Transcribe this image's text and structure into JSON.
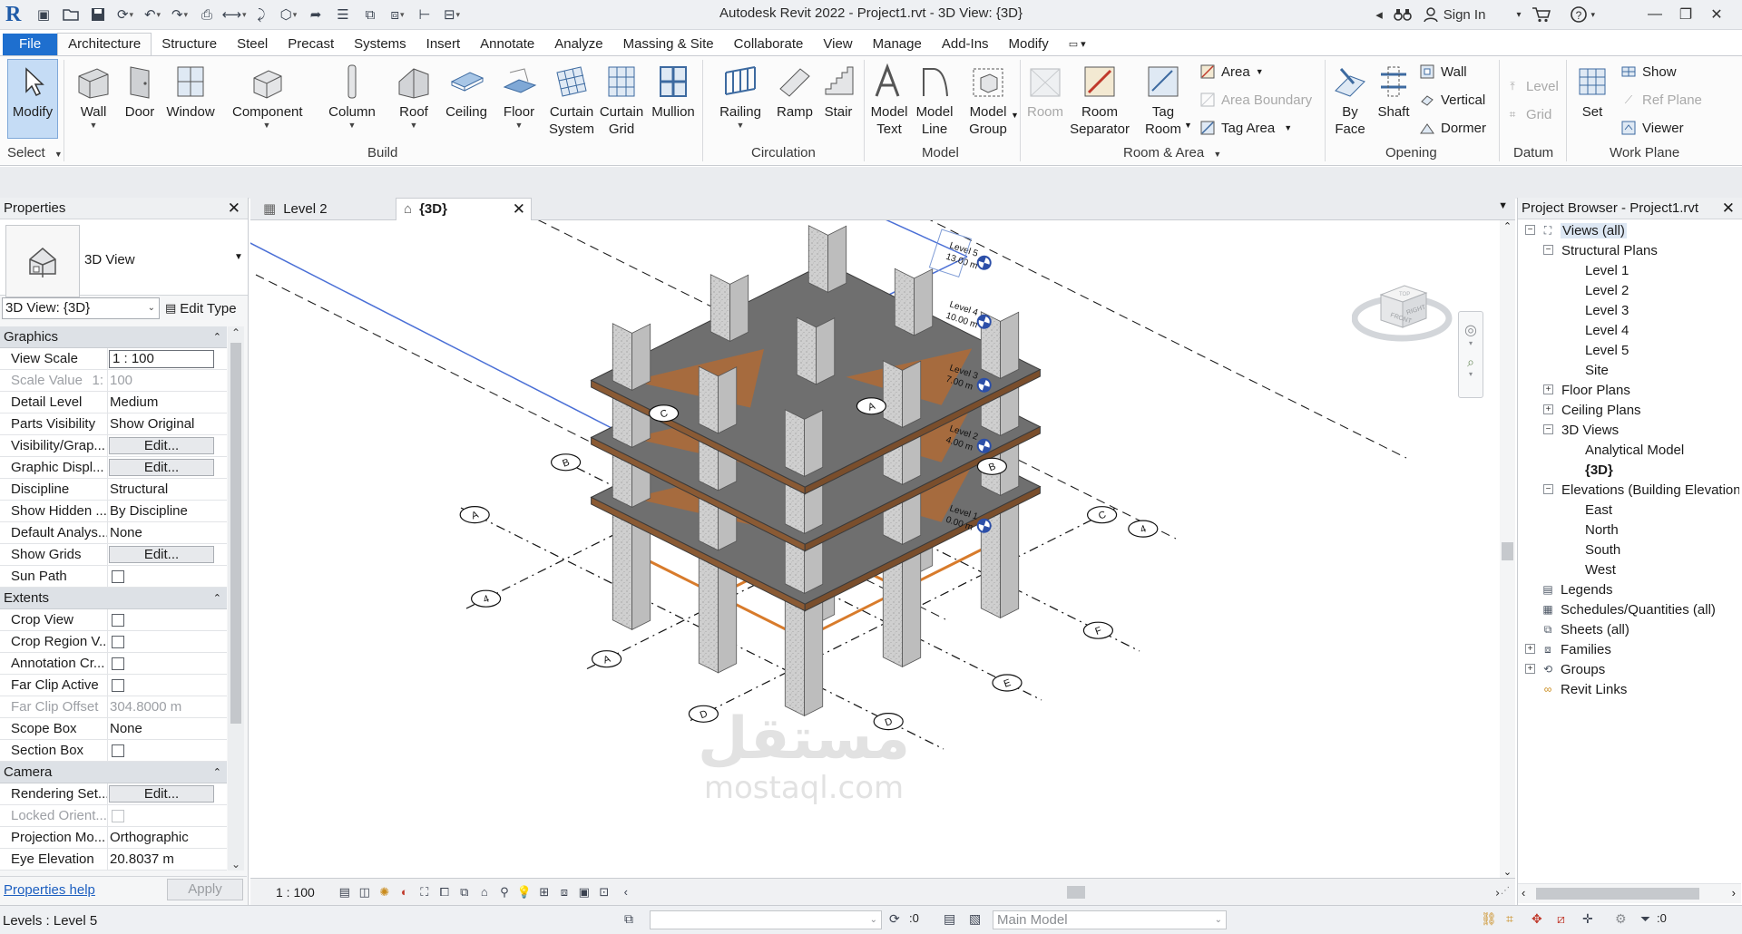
{
  "window": {
    "title": "Autodesk Revit 2022 - Project1.rvt - 3D View: {3D}",
    "sign_in": "Sign In"
  },
  "ribbon_tabs": [
    "File",
    "Architecture",
    "Structure",
    "Steel",
    "Precast",
    "Systems",
    "Insert",
    "Annotate",
    "Analyze",
    "Massing & Site",
    "Collaborate",
    "View",
    "Manage",
    "Add-Ins",
    "Modify"
  ],
  "active_tab": "Architecture",
  "ribbon": {
    "select": {
      "modify": "Modify",
      "panel": "Select"
    },
    "build": {
      "wall": "Wall",
      "door": "Door",
      "window": "Window",
      "component": "Component",
      "column": "Column",
      "roof": "Roof",
      "ceiling": "Ceiling",
      "floor": "Floor",
      "curtain_system_1": "Curtain",
      "curtain_system_2": "System",
      "curtain_grid_1": "Curtain",
      "curtain_grid_2": "Grid",
      "mullion": "Mullion",
      "panel": "Build"
    },
    "circulation": {
      "railing": "Railing",
      "ramp": "Ramp",
      "stair": "Stair",
      "panel": "Circulation"
    },
    "model": {
      "model_text_1": "Model",
      "model_text_2": "Text",
      "model_line_1": "Model",
      "model_line_2": "Line",
      "model_group_1": "Model",
      "model_group_2": "Group",
      "panel": "Model"
    },
    "room_area": {
      "room": "Room",
      "room_sep_1": "Room",
      "room_sep_2": "Separator",
      "tag_room_1": "Tag",
      "tag_room_2": "Room",
      "area": "Area",
      "area_boundary": "Area  Boundary",
      "tag_area": "Tag  Area",
      "panel": "Room & Area"
    },
    "opening": {
      "by_face_1": "By",
      "by_face_2": "Face",
      "shaft": "Shaft",
      "wall": "Wall",
      "vertical": "Vertical",
      "dormer": "Dormer",
      "panel": "Opening"
    },
    "datum": {
      "level": "Level",
      "grid": "Grid",
      "panel": "Datum"
    },
    "work_plane": {
      "set": "Set",
      "show": "Show",
      "ref_plane": "Ref  Plane",
      "viewer": "Viewer",
      "panel": "Work Plane"
    }
  },
  "properties": {
    "title": "Properties",
    "type_name": "3D View",
    "instance": "3D View: {3D}",
    "edit_type": "Edit Type",
    "groups": {
      "graphics": "Graphics",
      "extents": "Extents",
      "camera": "Camera"
    },
    "rows": {
      "view_scale": {
        "name": "View Scale",
        "value": "1 : 100"
      },
      "scale_value": {
        "name": "Scale Value",
        "prefix": "1:",
        "value": "100"
      },
      "detail_level": {
        "name": "Detail Level",
        "value": "Medium"
      },
      "parts_visibility": {
        "name": "Parts Visibility",
        "value": "Show Original"
      },
      "vis_graphics": {
        "name": "Visibility/Grap...",
        "value": "Edit..."
      },
      "graphic_display": {
        "name": "Graphic Displ...",
        "value": "Edit..."
      },
      "discipline": {
        "name": "Discipline",
        "value": "Structural"
      },
      "show_hidden": {
        "name": "Show Hidden ...",
        "value": "By Discipline"
      },
      "default_analysis": {
        "name": "Default Analys...",
        "value": "None"
      },
      "show_grids": {
        "name": "Show Grids",
        "value": "Edit..."
      },
      "sun_path": {
        "name": "Sun Path"
      },
      "crop_view": {
        "name": "Crop View"
      },
      "crop_region": {
        "name": "Crop Region V..."
      },
      "annotation_crop": {
        "name": "Annotation Cr..."
      },
      "far_clip_active": {
        "name": "Far Clip Active"
      },
      "far_clip_offset": {
        "name": "Far Clip Offset",
        "value": "304.8000 m"
      },
      "scope_box": {
        "name": "Scope Box",
        "value": "None"
      },
      "section_box": {
        "name": "Section Box"
      },
      "rendering": {
        "name": "Rendering Set...",
        "value": "Edit..."
      },
      "locked_orient": {
        "name": "Locked Orient..."
      },
      "projection": {
        "name": "Projection Mo...",
        "value": "Orthographic"
      },
      "eye_elevation": {
        "name": "Eye Elevation",
        "value": "20.8037 m"
      }
    },
    "help": "Properties help",
    "apply": "Apply"
  },
  "view_tabs": {
    "level2": "Level 2",
    "3d": "{3D}"
  },
  "levels": [
    {
      "name": "Level 5",
      "elev": "13.00 m"
    },
    {
      "name": "Level 4",
      "elev": "10.00 m"
    },
    {
      "name": "Level 3",
      "elev": "7.00 m"
    },
    {
      "name": "Level 2",
      "elev": "4.00 m"
    },
    {
      "name": "Level 1",
      "elev": "0.00 m"
    }
  ],
  "grid_labels": [
    "A",
    "B",
    "C",
    "D",
    "E",
    "F",
    "A",
    "B",
    "C",
    "4",
    "A",
    "D",
    "4"
  ],
  "viewcube": {
    "front": "FRONT",
    "right": "RIGHT",
    "top": "TOP"
  },
  "view_control": {
    "scale": "1 : 100"
  },
  "browser": {
    "title": "Project Browser - Project1.rvt",
    "items": {
      "views_all": "Views (all)",
      "structural_plans": "Structural Plans",
      "sp_level1": "Level 1",
      "sp_level2": "Level 2",
      "sp_level3": "Level 3",
      "sp_level4": "Level 4",
      "sp_level5": "Level 5",
      "sp_site": "Site",
      "floor_plans": "Floor Plans",
      "ceiling_plans": "Ceiling Plans",
      "views_3d": "3D Views",
      "analytical_model": "Analytical Model",
      "view_3d": "{3D}",
      "elevations": "Elevations (Building Elevation)",
      "east": "East",
      "north": "North",
      "south": "South",
      "west": "West",
      "legends": "Legends",
      "schedules": "Schedules/Quantities (all)",
      "sheets": "Sheets (all)",
      "families": "Families",
      "groups": "Groups",
      "revit_links": "Revit Links"
    }
  },
  "status": {
    "text": "Levels : Level 5",
    "count": ":0",
    "model": "Main Model",
    "filter_count": ":0"
  },
  "watermark": {
    "arabic": "مستقل",
    "latin": "mostaql.com"
  },
  "colors": {
    "file_tab": "#1e6fcf",
    "accent": "#1d5fc0",
    "slab": "#8a5a34",
    "column": "#cfcfcf",
    "level_line": "#4a6fd6"
  }
}
